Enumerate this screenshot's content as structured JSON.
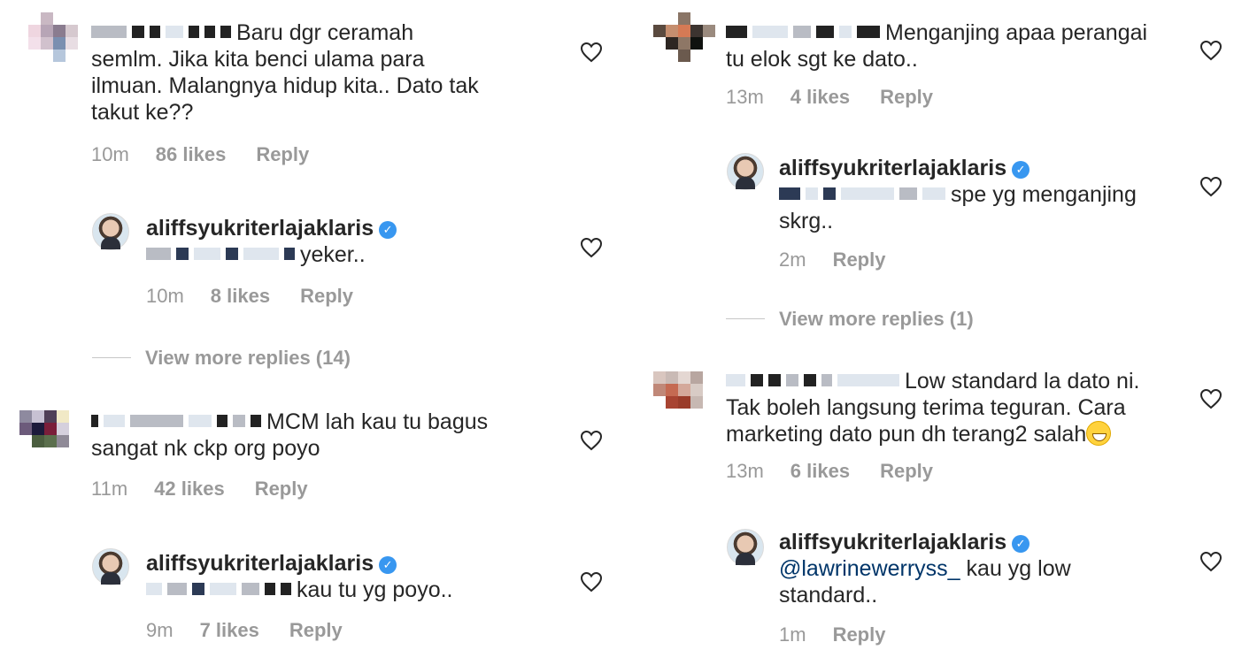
{
  "owner": {
    "username": "aliffsyukriterlajaklaris",
    "verified_icon": "verified-badge-icon"
  },
  "left": {
    "comments": [
      {
        "text": "Baru dgr ceramah semlm. Jika kita benci ulama para ilmuan. Malangnya hidup kita.. Dato tak takut ke??",
        "line1": "Baru dgr ceramah",
        "line2": "semlm. Jika kita benci ulama para",
        "line3": "ilmuan. Malangnya hidup kita.. Dato tak",
        "line4": "takut ke??",
        "time": "10m",
        "likes": "86 likes",
        "reply": "Reply",
        "replies": {
          "text": "yeker..",
          "time": "10m",
          "likes": "8 likes",
          "reply": "Reply"
        },
        "view_more": "View more replies (14)"
      },
      {
        "line1": "MCM lah kau tu bagus",
        "line2": "sangat nk ckp org poyo",
        "time": "11m",
        "likes": "42 likes",
        "reply": "Reply",
        "replies": {
          "text": "kau tu yg poyo..",
          "time": "9m",
          "likes": "7 likes",
          "reply": "Reply"
        }
      }
    ]
  },
  "right": {
    "comments": [
      {
        "line1": "Menganjing apaa perangai",
        "line2": "tu elok sgt ke dato..",
        "time": "13m",
        "likes": "4 likes",
        "reply": "Reply",
        "replies": {
          "line1": "spe yg menganjing",
          "line2": "skrg..",
          "time": "2m",
          "reply": "Reply"
        },
        "view_more": "View more replies (1)"
      },
      {
        "line1": "Low standard la dato ni.",
        "line2": "Tak boleh langsung terima teguran. Cara",
        "line3": "marketing dato pun dh terang2 salah",
        "time": "13m",
        "likes": "6 likes",
        "reply": "Reply",
        "replies": {
          "mention": "@lawrinewerryss_",
          "line1_rest": " kau yg low",
          "line2": "standard..",
          "time": "1m",
          "reply": "Reply"
        }
      }
    ]
  },
  "colors": {
    "text": "#262626",
    "meta": "#999999",
    "verified": "#3897f0",
    "mention": "#003569"
  }
}
